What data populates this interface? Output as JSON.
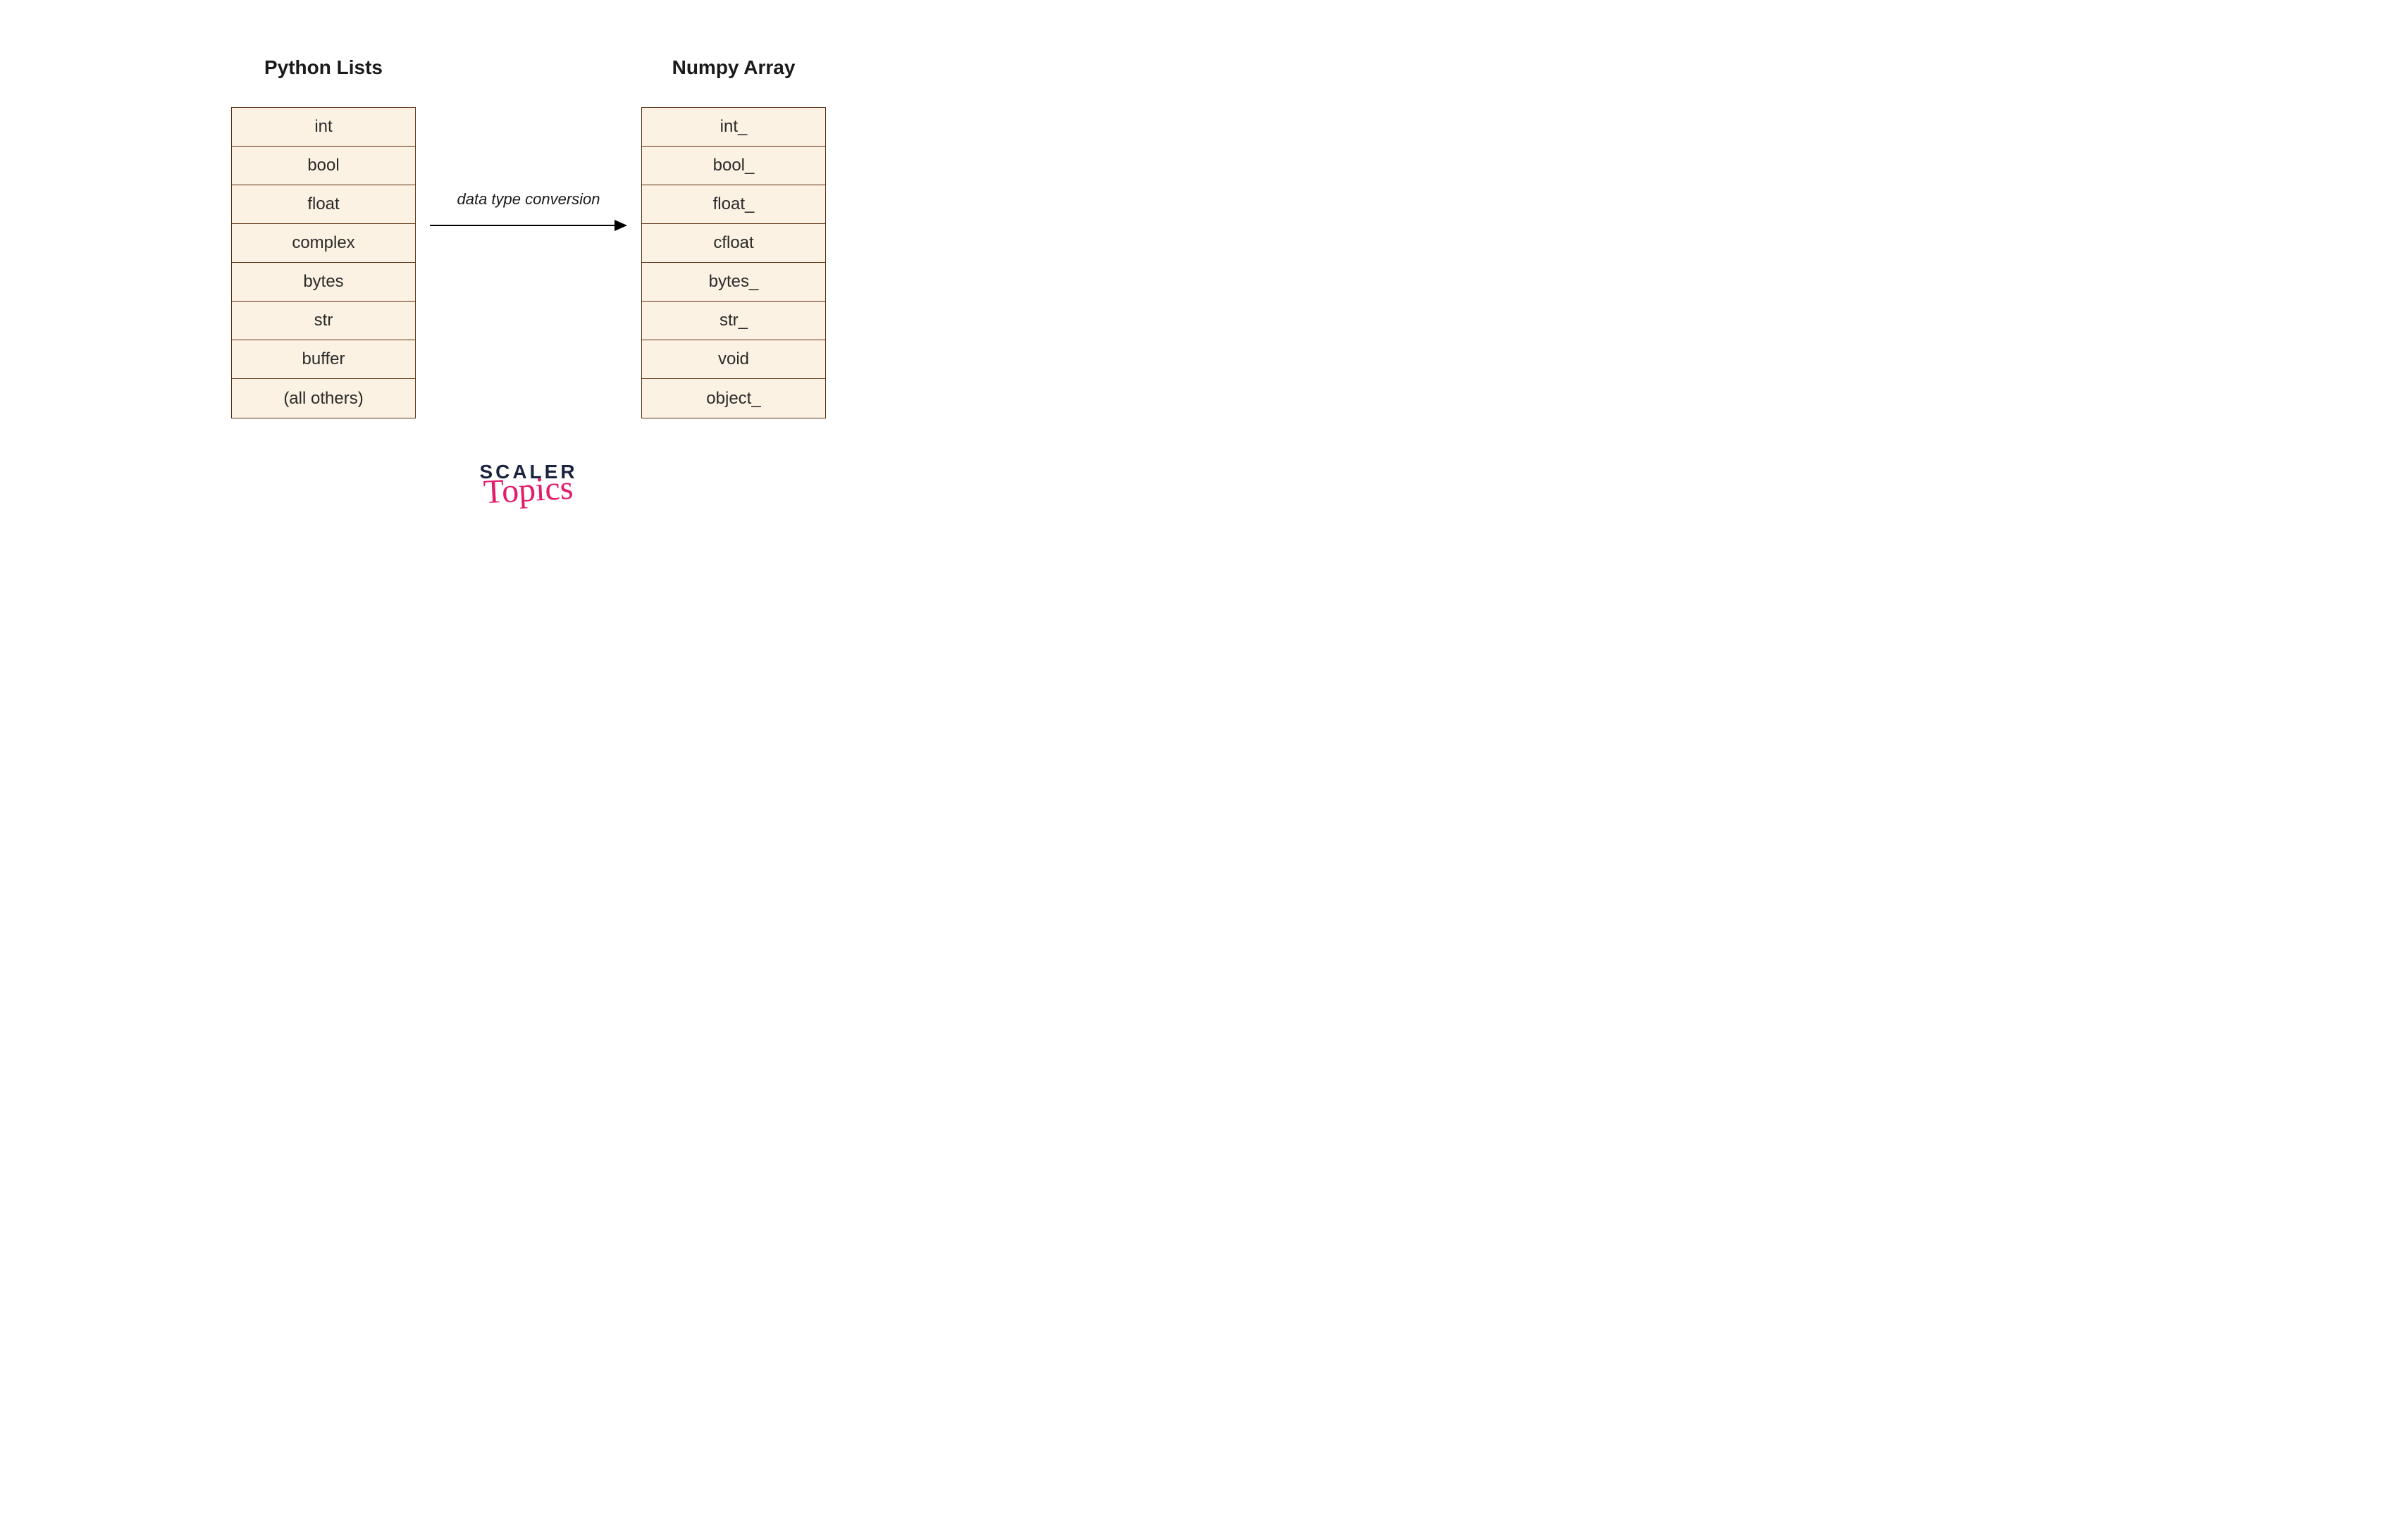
{
  "left": {
    "title": "Python Lists",
    "items": [
      "int",
      "bool",
      "float",
      "complex",
      "bytes",
      "str",
      "buffer",
      "(all others)"
    ]
  },
  "right": {
    "title": "Numpy Array",
    "items": [
      "int_",
      "bool_",
      "float_",
      "cfloat",
      "bytes_",
      "str_",
      "void",
      "object_"
    ]
  },
  "arrow": {
    "label": "data type conversion"
  },
  "logo": {
    "line1": "SCALER",
    "line2": "Topics"
  }
}
